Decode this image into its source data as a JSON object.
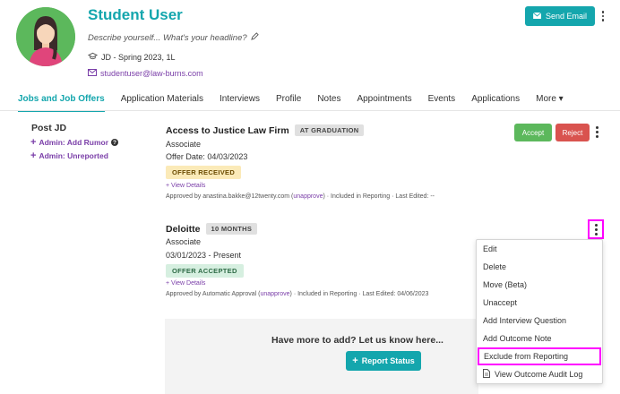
{
  "profile": {
    "name": "Student User",
    "headline_placeholder": "Describe yourself... What's your headline?",
    "program": "JD - Spring 2023, 1L",
    "email": "studentuser@law-burns.com",
    "send_email_label": "Send Email"
  },
  "tabs": [
    {
      "label": "Jobs and Job Offers",
      "active": true
    },
    {
      "label": "Application Materials"
    },
    {
      "label": "Interviews"
    },
    {
      "label": "Profile"
    },
    {
      "label": "Notes"
    },
    {
      "label": "Appointments"
    },
    {
      "label": "Events"
    },
    {
      "label": "Applications"
    },
    {
      "label": "More ▾"
    }
  ],
  "left_panel": {
    "title": "Post JD",
    "links": [
      "Admin: Add Rumor",
      "Admin: Unreported"
    ]
  },
  "jobs": [
    {
      "employer": "Access to Justice Law Firm",
      "tag": "AT GRADUATION",
      "title": "Associate",
      "date": "Offer Date: 04/03/2023",
      "status": "OFFER RECEIVED",
      "view_details": "+ View Details",
      "meta_prefix": "Approved by anastina.bakke@12twenty.com (",
      "meta_link": "unapprove",
      "meta_suffix": ") · Included in Reporting · Last Edited: --",
      "accept_label": "Accept",
      "reject_label": "Reject"
    },
    {
      "employer": "Deloitte",
      "tag": "10 MONTHS",
      "title": "Associate",
      "date": "03/01/2023 - Present",
      "status": "OFFER ACCEPTED",
      "view_details": "+ View Details",
      "meta_prefix": "Approved by Automatic Approval (",
      "meta_link": "unapprove",
      "meta_suffix": ") · Included in Reporting · Last Edited: 04/06/2023"
    }
  ],
  "add_more": {
    "text": "Have more to add? Let us know here...",
    "button_label": "Report Status"
  },
  "menu": {
    "items": [
      "Edit",
      "Delete",
      "Move (Beta)",
      "Unaccept",
      "Add Interview Question",
      "Add Outcome Note",
      "Exclude from Reporting",
      "View Outcome Audit Log"
    ],
    "highlighted_index": 6
  },
  "colors": {
    "brand": "#14a6ad",
    "link": "#7a3ea8",
    "highlight": "#ff00ff",
    "accept": "#5cb85c",
    "reject": "#d9534f"
  }
}
